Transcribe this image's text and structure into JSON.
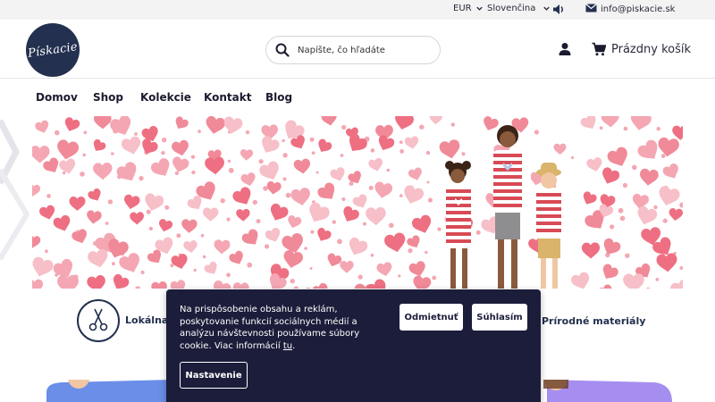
{
  "topbar": {
    "currency": "EUR",
    "language": "Slovenčina",
    "email": "info@piskacie.sk"
  },
  "header": {
    "logo_text": "Pískacie",
    "search_placeholder": "Napíšte, čo hľadáte",
    "cart_label": "Prázdny košík"
  },
  "nav": {
    "items": [
      "Domov",
      "Shop",
      "Kolekcie",
      "Kontakt",
      "Blog"
    ]
  },
  "features": {
    "left_label": "Lokálna",
    "right_label": "Prírodné materiály"
  },
  "cookie": {
    "text_before": "Na prispôsobenie obsahu a reklám, poskytovanie funkcií sociálnych médií a analýzu návštevnosti používame súbory cookie. Viac informácií ",
    "link_text": "tu",
    "text_after": ".",
    "decline_label": "Odmietnuť",
    "accept_label": "Súhlasím",
    "settings_label": "Nastavenie"
  },
  "colors": {
    "brand_navy": "#23304f",
    "cookie_bg": "#1b1d3a",
    "heart_pink": "#f08a98",
    "stripe_red": "#d84a55"
  },
  "icons": [
    "chevron-down-icon",
    "speaker-icon",
    "mail-icon",
    "search-icon",
    "user-icon",
    "cart-icon",
    "scissors-icon"
  ]
}
